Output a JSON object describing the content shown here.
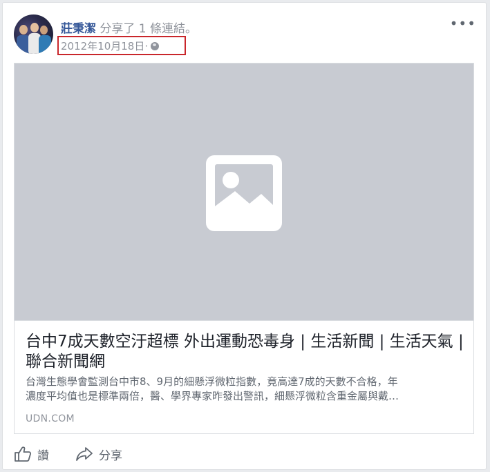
{
  "post": {
    "author": "莊秉潔",
    "action_text": " 分享了 1 條連結。",
    "timestamp": "2012年10月18日",
    "timestamp_sep": " · ",
    "privacy_icon": "globe-icon",
    "more_label": "•••"
  },
  "link": {
    "title": "台中7成天數空汙超標 外出運動恐毒身 | 生活新聞 | 生活天氣 | 聯合新聞網",
    "description_line1": "台灣生態學會監測台中市8、9月的細懸浮微粒指數，竟高達7成的天數不合格，年",
    "description_line2": "濃度平均值也是標準兩倍，醫、學界專家昨發出警訊，細懸浮微粒含重金屬與戴…",
    "domain": "UDN.COM",
    "image_icon": "image-placeholder-icon"
  },
  "actions": {
    "like_label": "讚",
    "share_label": "分享"
  },
  "colors": {
    "author": "#365899",
    "meta": "#90949c",
    "highlight_box": "#c9262b",
    "image_bg": "#c8cbd2"
  }
}
